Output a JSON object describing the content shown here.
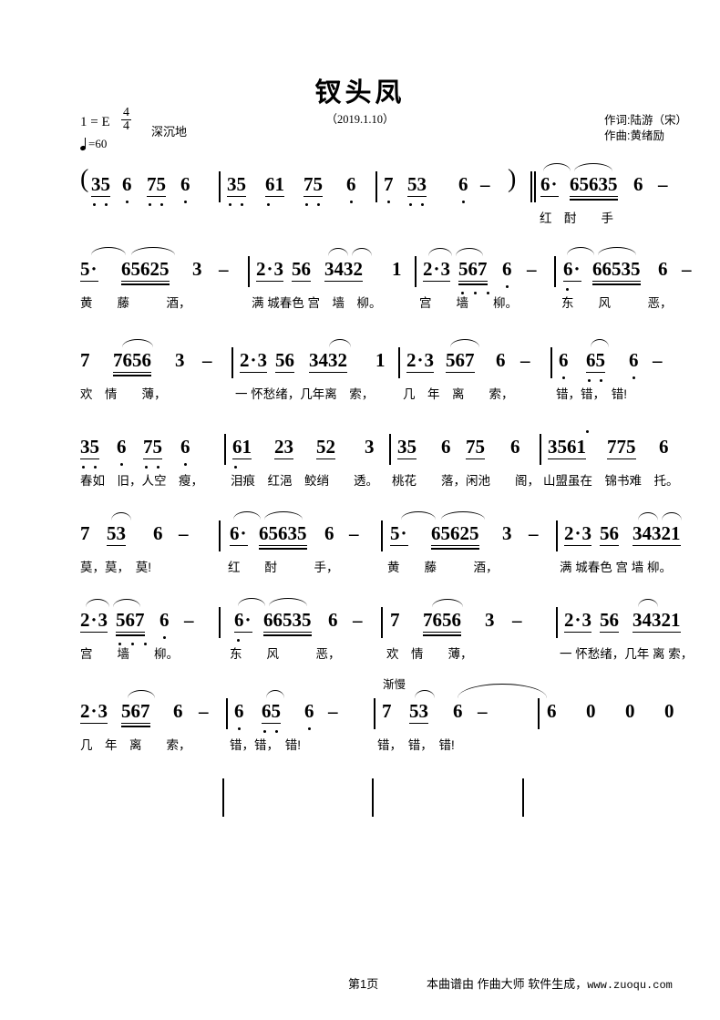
{
  "header": {
    "title": "钗头凤",
    "subtitle": "（2019.1.10）",
    "lyricist": "作词:陆游（宋）",
    "composer": "作曲:黄绪励",
    "key_signature": "1 = E",
    "meter_numerator": "4",
    "meter_denominator": "4",
    "mood": "深沉地",
    "tempo": "=60"
  },
  "footer": {
    "page_number": "第1页",
    "generator": "本曲谱由  作曲大师  软件生成，",
    "url": "www.zuoqu.com"
  },
  "chart_data": {
    "type": "table",
    "title": "钗头凤",
    "notation": "jianpu",
    "key": "E",
    "time_signature": "4/4",
    "tempo_bpm": 60,
    "lines": [
      {
        "index": 1,
        "measures": [
          {
            "notes": "35 6 75 6",
            "lyrics": ""
          },
          {
            "notes": "35 61 75 6",
            "lyrics": ""
          },
          {
            "notes": "7 53 6 -",
            "lyrics": ""
          },
          {
            "notes": "6·65635 6 -",
            "lyrics": "红 酎 手"
          }
        ]
      },
      {
        "index": 2,
        "measures": [
          {
            "notes": "5· 65625 3 -",
            "lyrics": "黄 藤 酒，"
          },
          {
            "notes": "2·356 3432 1",
            "lyrics": "满 城春色 宫 墙 柳。"
          },
          {
            "notes": "2·3567 6 -",
            "lyrics": "宫 墙 柳。"
          },
          {
            "notes": "6·66535 6 -",
            "lyrics": "东 风 恶，"
          }
        ]
      },
      {
        "index": 3,
        "measures": [
          {
            "notes": "7 7656 3 -",
            "lyrics": "欢 情 薄，"
          },
          {
            "notes": "2·356 3432 1",
            "lyrics": "一 怀愁绪，几年离 索，"
          },
          {
            "notes": "2·3 567 6 -",
            "lyrics": "几 年 离 索，"
          },
          {
            "notes": "6 65 6 -",
            "lyrics": "错，错， 错!"
          }
        ]
      },
      {
        "index": 4,
        "measures": [
          {
            "notes": "35 6 75 6",
            "lyrics": "春如 旧，人空 瘦，"
          },
          {
            "notes": "61 23 52 3",
            "lyrics": "泪痕 红浥 鲛绡 透。"
          },
          {
            "notes": "35 6 75 6",
            "lyrics": "桃花 落，闲池 阁，"
          },
          {
            "notes": "3561 775 6",
            "lyrics": "山盟虽在 锦书难 托。"
          }
        ]
      },
      {
        "index": 5,
        "measures": [
          {
            "notes": "7 53 6 -",
            "lyrics": "莫，莫， 莫!"
          },
          {
            "notes": "6·65635 6 -",
            "lyrics": "红 酎 手，"
          },
          {
            "notes": "5· 65625 3 -",
            "lyrics": "黄 藤 酒，"
          },
          {
            "notes": "2·356 34321",
            "lyrics": "满 城春色 宫 墙 柳。"
          }
        ]
      },
      {
        "index": 6,
        "measures": [
          {
            "notes": "2·3567 6 -",
            "lyrics": "宫 墙 柳。"
          },
          {
            "notes": "6·66535 6 -",
            "lyrics": "东 风 恶，"
          },
          {
            "notes": "7 7656 3 -",
            "lyrics": "欢 情 薄，"
          },
          {
            "notes": "2·356 34321",
            "lyrics": "一 怀愁绪，几年 离 索，"
          }
        ]
      },
      {
        "index": 7,
        "measures": [
          {
            "notes": "2·3 567 6 -",
            "lyrics": "几 年 离 索，"
          },
          {
            "notes": "6 65 6 -",
            "lyrics": "错，错， 错!"
          },
          {
            "notes": "7 53 6 -",
            "lyrics": "错， 错， 错!",
            "expression": "渐慢"
          },
          {
            "notes": "6 0 0 0",
            "lyrics": ""
          }
        ]
      }
    ]
  }
}
